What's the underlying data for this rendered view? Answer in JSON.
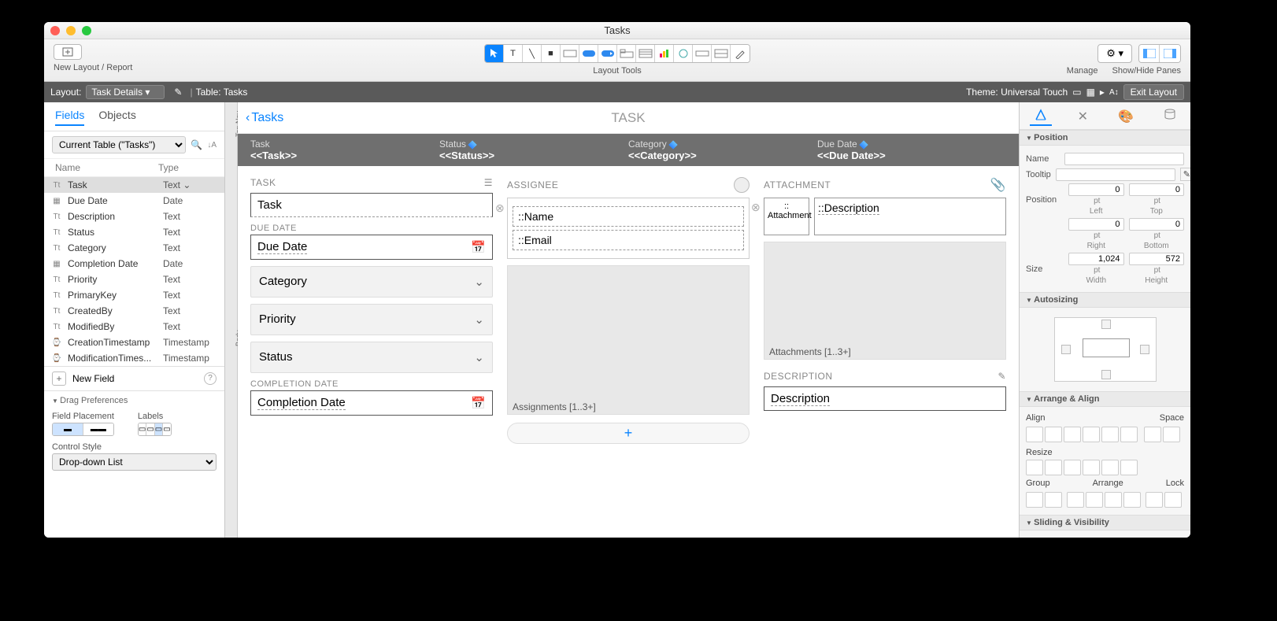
{
  "window": {
    "title": "Tasks"
  },
  "toolbar": {
    "new_layout_label": "New Layout / Report",
    "layout_tools_label": "Layout Tools",
    "manage_label": "Manage",
    "panes_label": "Show/Hide Panes"
  },
  "layoutbar": {
    "layout_label": "Layout:",
    "layout_value": "Task Details",
    "table_label": "Table: Tasks",
    "theme_label": "Theme: Universal Touch",
    "exit_label": "Exit Layout"
  },
  "left": {
    "tabs": {
      "fields": "Fields",
      "objects": "Objects"
    },
    "source": "Current Table (\"Tasks\")",
    "col_name": "Name",
    "col_type": "Type",
    "fields": [
      {
        "icon": "Tt",
        "name": "Task",
        "type": "Text",
        "selected": true
      },
      {
        "icon": "▦",
        "name": "Due Date",
        "type": "Date"
      },
      {
        "icon": "Tt",
        "name": "Description",
        "type": "Text"
      },
      {
        "icon": "Tt",
        "name": "Status",
        "type": "Text"
      },
      {
        "icon": "Tt",
        "name": "Category",
        "type": "Text"
      },
      {
        "icon": "▦",
        "name": "Completion Date",
        "type": "Date"
      },
      {
        "icon": "Tt",
        "name": "Priority",
        "type": "Text"
      },
      {
        "icon": "Tt",
        "name": "PrimaryKey",
        "type": "Text"
      },
      {
        "icon": "Tt",
        "name": "CreatedBy",
        "type": "Text"
      },
      {
        "icon": "Tt",
        "name": "ModifiedBy",
        "type": "Text"
      },
      {
        "icon": "⌚",
        "name": "CreationTimestamp",
        "type": "Timestamp"
      },
      {
        "icon": "⌚",
        "name": "ModificationTimes...",
        "type": "Timestamp"
      }
    ],
    "new_field": "New Field",
    "drag_prefs": "Drag Preferences",
    "field_placement": "Field Placement",
    "labels": "Labels",
    "control_style_label": "Control Style",
    "control_style_value": "Drop-down List"
  },
  "parts": {
    "topnav": "Top Nav…",
    "body": "Body"
  },
  "canvas": {
    "back": "Tasks",
    "title": "TASK",
    "header_cols": [
      {
        "label": "Task",
        "merge": "<<Task>>"
      },
      {
        "label": "Status",
        "merge": "<<Status>>"
      },
      {
        "label": "Category",
        "merge": "<<Category>>"
      },
      {
        "label": "Due Date",
        "merge": "<<Due Date>>"
      }
    ],
    "task_section": "TASK",
    "task_field": "Task",
    "duedate_section": "DUE DATE",
    "duedate_field": "Due Date",
    "category": "Category",
    "priority": "Priority",
    "status": "Status",
    "completion_section": "COMPLETION DATE",
    "completion_field": "Completion Date",
    "assignee_section": "ASSIGNEE",
    "assignee_name": "::Name",
    "assignee_email": "::Email",
    "assignments_portal": "Assignments [1..3+]",
    "attachment_section": "ATTACHMENT",
    "attachment_box": ":: Attachment",
    "attachment_desc": "::Description",
    "attachments_portal": "Attachments [1..3+]",
    "description_section": "DESCRIPTION",
    "description_field": "Description"
  },
  "inspector": {
    "position_h": "Position",
    "name_label": "Name",
    "name_value": "",
    "tooltip_label": "Tooltip",
    "tooltip_value": "",
    "position_label": "Position",
    "left": "0",
    "top": "0",
    "right": "0",
    "bottom": "0",
    "left_l": "Left",
    "top_l": "Top",
    "right_l": "Right",
    "bottom_l": "Bottom",
    "size_label": "Size",
    "width": "1,024",
    "height": "572",
    "width_l": "Width",
    "height_l": "Height",
    "autosizing_h": "Autosizing",
    "arrange_h": "Arrange & Align",
    "align_l": "Align",
    "space_l": "Space",
    "resize_l": "Resize",
    "group_l": "Group",
    "arrange_l2": "Arrange",
    "lock_l": "Lock",
    "sliding_h": "Sliding & Visibility"
  }
}
